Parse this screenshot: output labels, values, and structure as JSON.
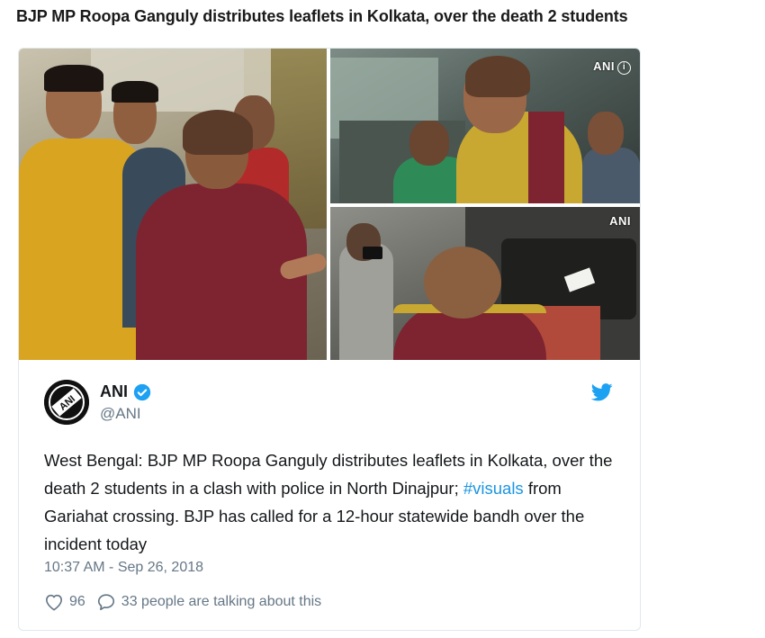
{
  "article": {
    "headline": "BJP MP Roopa Ganguly distributes leaflets in Kolkata, over the death 2 students"
  },
  "media": {
    "photos": [
      {
        "badge": ""
      },
      {
        "badge": "ANI"
      },
      {
        "badge": "ANI"
      }
    ]
  },
  "tweet": {
    "account_name": "ANI",
    "handle": "@ANI",
    "avatar_text": "ANI",
    "text_before": "West Bengal: BJP MP Roopa Ganguly distributes leaflets in Kolkata, over the death 2 students in a clash with police in North Dinajpur; ",
    "hashtag": "#visuals",
    "text_after": " from Gariahat crossing. BJP has called for a 12-hour statewide bandh over the incident today",
    "timestamp": "10:37 AM - Sep 26, 2018",
    "like_count": "96",
    "talking_text": "33 people are talking about this",
    "icons": {
      "verified": "verified-badge-icon",
      "bird": "twitter-bird-icon",
      "like": "heart-icon",
      "reply": "speech-bubble-icon"
    },
    "colors": {
      "link": "#1b95e0",
      "verified": "#1da1f2",
      "bird": "#1da1f2",
      "muted": "#657786"
    }
  }
}
